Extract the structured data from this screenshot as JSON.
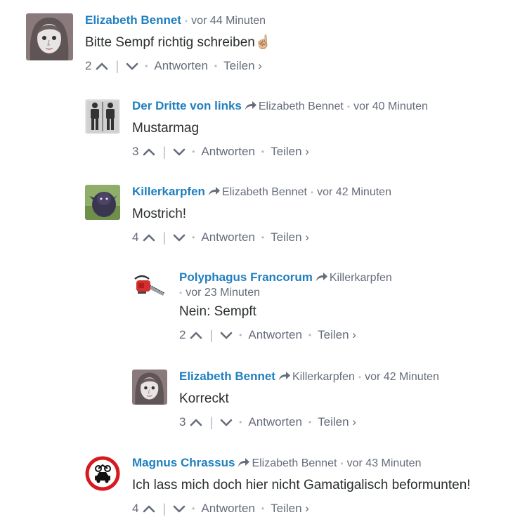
{
  "comments": [
    {
      "author": "Elizabeth Bennet",
      "time": "vor 44 Minuten",
      "message": "Bitte Sempf richtig schreiben",
      "emoji": "☝🏼",
      "votes": "2",
      "reply_label": "Antworten",
      "share_label": "Teilen ›",
      "avatar_icon": "woman-sketch-avatar"
    },
    {
      "author": "Der Dritte von links",
      "parent": "Elizabeth Bennet",
      "time": "vor 40 Minuten",
      "message": "Mustarmag",
      "votes": "3",
      "reply_label": "Antworten",
      "share_label": "Teilen ›",
      "avatar_icon": "restroom-people-avatar"
    },
    {
      "author": "Killerkarpfen",
      "parent": "Elizabeth Bennet",
      "time": "vor 42 Minuten",
      "message": "Mostrich!",
      "votes": "4",
      "reply_label": "Antworten",
      "share_label": "Teilen ›",
      "avatar_icon": "purple-creature-avatar"
    },
    {
      "author": "Polyphagus Francorum",
      "parent": "Killerkarpfen",
      "time": "vor 23 Minuten",
      "message": "Nein: Sempft",
      "votes": "2",
      "reply_label": "Antworten",
      "share_label": "Teilen ›",
      "avatar_icon": "chainsaw-avatar"
    },
    {
      "author": "Elizabeth Bennet",
      "parent": "Killerkarpfen",
      "time": "vor 42 Minuten",
      "message": "Korreckt",
      "votes": "3",
      "reply_label": "Antworten",
      "share_label": "Teilen ›",
      "avatar_icon": "woman-sketch-avatar"
    },
    {
      "author": "Magnus Chrassus",
      "parent": "Elizabeth Bennet",
      "time": "vor 43 Minuten",
      "message": "Ich lass mich doch hier nicht Gamatigalisch beformunten!",
      "votes": "4",
      "reply_label": "Antworten",
      "share_label": "Teilen ›",
      "avatar_icon": "no-vehicles-sign-avatar"
    }
  ],
  "colors": {
    "author": "#1f7fbf",
    "meta": "#656c7a",
    "text": "#2a2e2e",
    "separator": "#b4b8be"
  }
}
